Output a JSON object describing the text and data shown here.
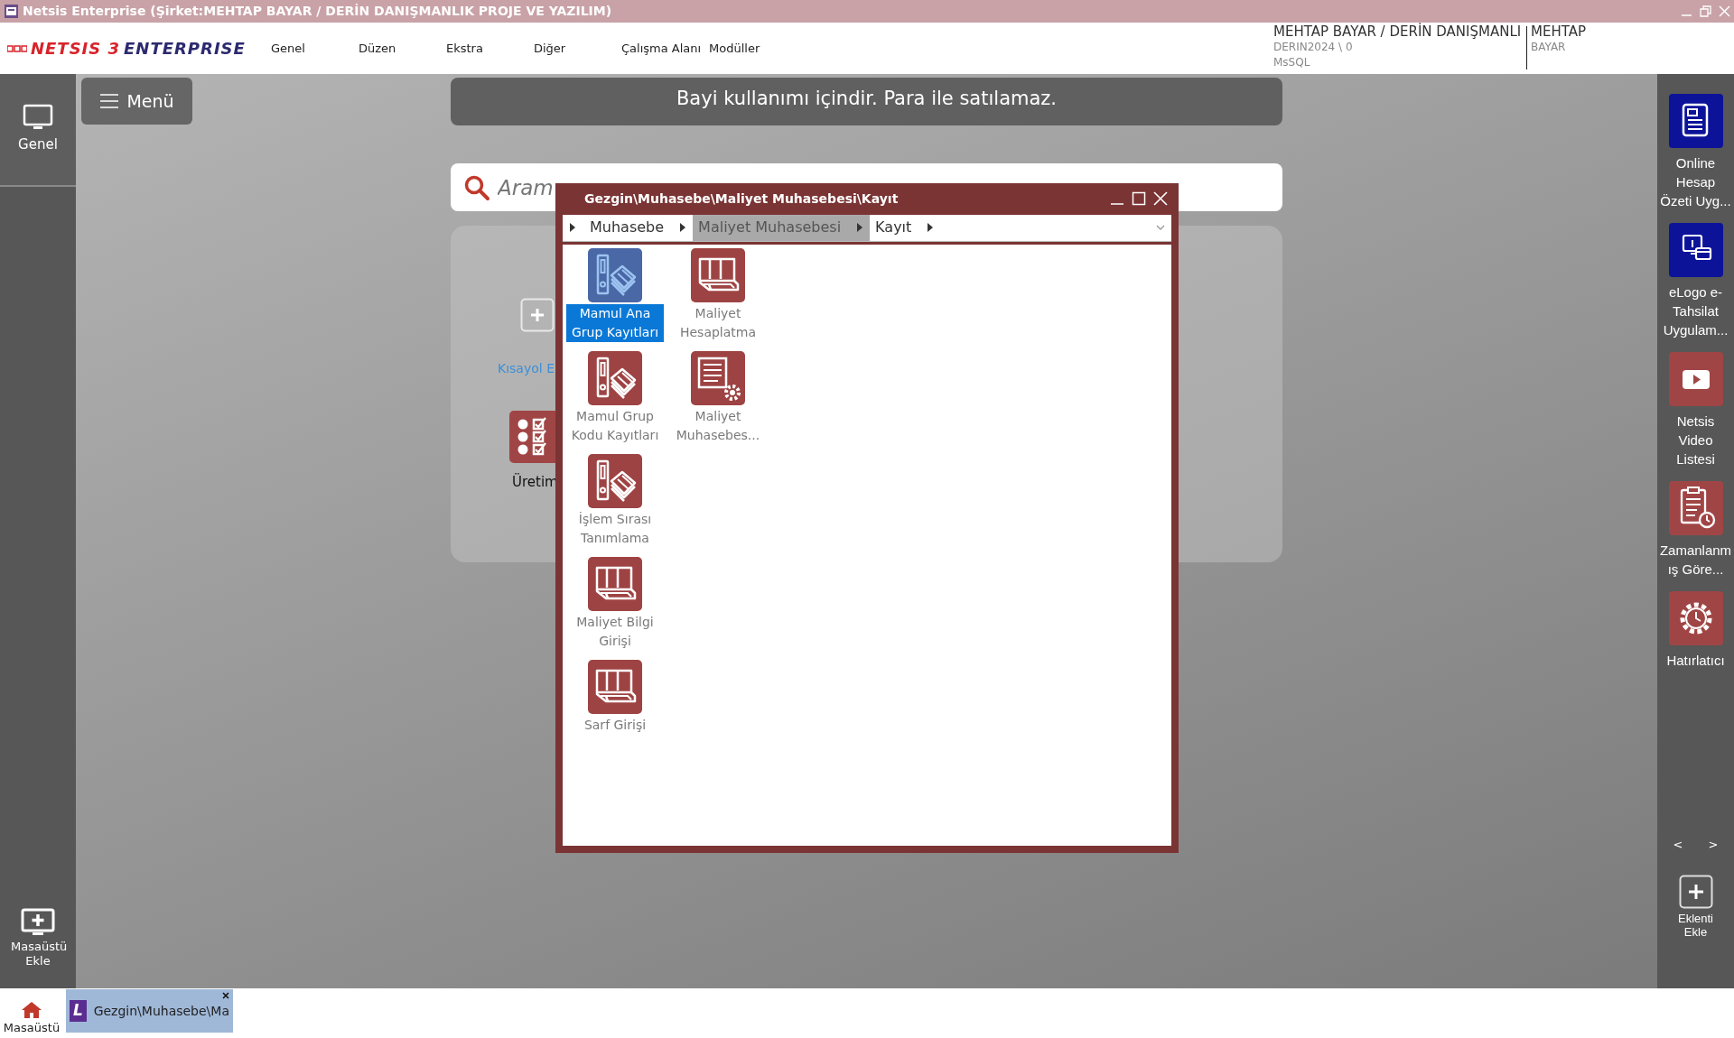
{
  "window": {
    "title": "Netsis Enterprise (Şirket:MEHTAP BAYAR / DERİN DANIŞMANLIK PROJE VE YAZILIM)"
  },
  "header": {
    "logo_main": "NETSIS 3",
    "logo_sub": "ENTERPRISE",
    "menu": [
      "Genel",
      "Düzen",
      "Ekstra",
      "Diğer",
      "Çalışma Alanı",
      "Modüller"
    ],
    "account": {
      "company": "MEHTAP BAYAR / DERİN DANIŞMANLI",
      "database": "DERIN2024 \\ 0",
      "server": "MsSQL",
      "user_first": "MEHTAP",
      "user_last": "BAYAR"
    }
  },
  "left_sidebar": {
    "top_item": "Genel",
    "bottom_item": "Masaüstü Ekle"
  },
  "menu_button": "Menü",
  "banner": "Bayi kullanımı içindir. Para ile satılamaz.",
  "search": {
    "placeholder": "Aram"
  },
  "shortcuts": [
    {
      "kind": "add",
      "label": "Kısayol E"
    },
    {
      "kind": "module",
      "label": "Üretim"
    }
  ],
  "dialog": {
    "title": "Gezgin\\Muhasebe\\Maliyet Muhasebesi\\Kayıt",
    "breadcrumb": [
      {
        "label": "Muhasebe",
        "selected": false
      },
      {
        "label": "Maliyet Muhasebesi",
        "selected": true
      },
      {
        "label": "Kayıt",
        "selected": false
      }
    ],
    "items": [
      {
        "label": "Mamul Ana Grup Kayıtları",
        "kind": "binder",
        "selected": true
      },
      {
        "label": "Mamul Grup Kodu Kayıtları",
        "kind": "binder",
        "selected": false
      },
      {
        "label": "İşlem Sırası Tanımlama",
        "kind": "binder",
        "selected": false
      },
      {
        "label": "Maliyet Bilgi Girişi",
        "kind": "stack",
        "selected": false
      },
      {
        "label": "Sarf Girişi",
        "kind": "stack",
        "selected": false
      },
      {
        "label": "Maliyet Hesaplatma",
        "kind": "stack",
        "selected": false
      },
      {
        "label": "Maliyet Muhasebes...",
        "kind": "docgear",
        "selected": false
      }
    ]
  },
  "right_sidebar": {
    "items": [
      {
        "label": "Online Hesap Özeti Uyg...",
        "kind": "document",
        "color": "#0c1399"
      },
      {
        "label": "eLogo e-Tahsilat Uygulam...",
        "kind": "payment",
        "color": "#0c1399"
      },
      {
        "label": "Netsis Video Listesi",
        "kind": "video",
        "color": "#a04545"
      },
      {
        "label": "Zamanlanmış Göre...",
        "kind": "clipboard",
        "color": "#a04545"
      },
      {
        "label": "Hatırlatıcı",
        "kind": "gear",
        "color": "#a04545"
      }
    ],
    "pager": [
      "<",
      ">"
    ],
    "add": "Eklenti Ekle"
  },
  "taskbar": {
    "home": "Masaüstü",
    "tabs": [
      {
        "badge": "L",
        "title": "Gezgin\\Muhasebe\\Ma",
        "selected": true
      }
    ]
  }
}
